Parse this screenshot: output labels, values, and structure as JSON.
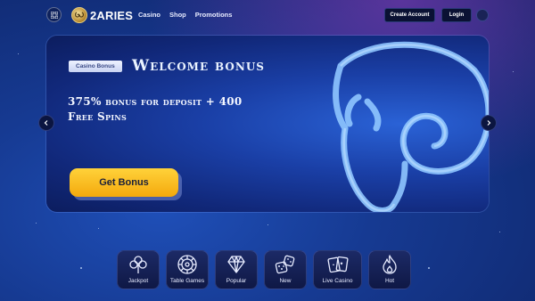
{
  "header": {
    "logo_text": "2ARIES",
    "nav": [
      "Casino",
      "Shop",
      "Promotions"
    ],
    "create_account": "Create Account",
    "login": "Login"
  },
  "banner": {
    "badge": "Casino Bonus",
    "title": "Welcome bonus",
    "subtitle": "375% bonus for deposit + 400 Free Spins",
    "cta": "Get Bonus"
  },
  "categories": [
    {
      "label": "Jackpot",
      "icon": "clover-icon"
    },
    {
      "label": "Table Games",
      "icon": "roulette-icon"
    },
    {
      "label": "Popular",
      "icon": "diamond-icon"
    },
    {
      "label": "New",
      "icon": "dice-icon"
    },
    {
      "label": "Live Casino",
      "icon": "cards-icon"
    },
    {
      "label": "Hot",
      "icon": "flame-icon"
    }
  ],
  "colors": {
    "accent_yellow": "#ffc529",
    "bg_blue": "#163a92",
    "button_dark": "#0a1133"
  }
}
